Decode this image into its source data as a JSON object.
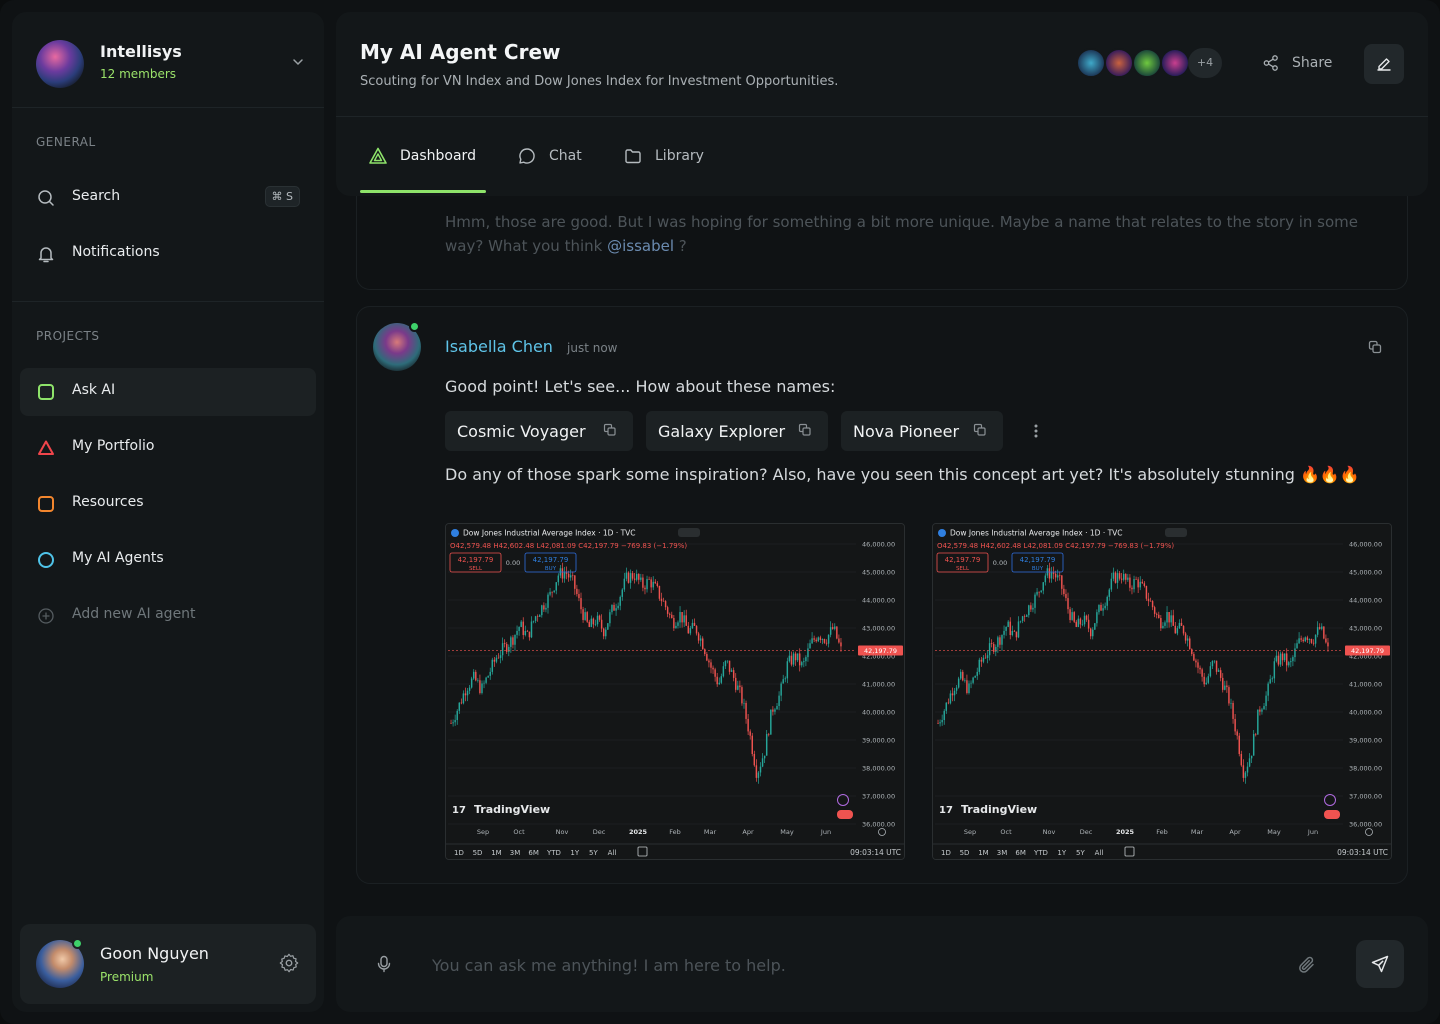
{
  "workspace": {
    "name": "Intellisys",
    "members": "12 members"
  },
  "sidebar": {
    "general_label": "GENERAL",
    "search_label": "Search",
    "search_shortcut": "⌘ S",
    "notifications_label": "Notifications",
    "projects_label": "PROJECTS",
    "projects": [
      {
        "label": "Ask AI",
        "color": "#8ee36a"
      },
      {
        "label": "My Portfolio",
        "color": "#f0454b"
      },
      {
        "label": "Resources",
        "color": "#f2862e"
      },
      {
        "label": "My AI Agents",
        "color": "#4fc3e8"
      }
    ],
    "add_agent_label": "Add new AI agent"
  },
  "user": {
    "name": "Goon Nguyen",
    "plan": "Premium"
  },
  "header": {
    "title": "My AI Agent Crew",
    "subtitle": "Scouting for VN Index and Dow Jones Index for Investment Opportunities.",
    "extra_members": "+4",
    "share_label": "Share"
  },
  "tabs": [
    {
      "label": "Dashboard"
    },
    {
      "label": "Chat"
    },
    {
      "label": "Library"
    }
  ],
  "previous_message": {
    "text": "Hmm, those are good. But I was hoping for something a bit more unique. Maybe a name that relates to the story in some way? What you think ",
    "mention": "@issabel",
    "suffix": " ?"
  },
  "message": {
    "author": "Isabella Chen",
    "time": "just now",
    "intro": "Good point! Let's see... How about these names:",
    "suggestions": [
      "Cosmic Voyager",
      "Galaxy Explorer",
      "Nova Pioneer"
    ],
    "followup": "Do any of those spark some inspiration? Also, have you seen this concept art yet? It's absolutely stunning 🔥🔥🔥"
  },
  "chart_data": [
    {
      "type": "candlestick",
      "title": "Dow Jones Industrial Average Index · 1D · TVC",
      "ohlc": "O42,579.48 H42,602.48 L42,081.09 C42,197.79 −769.83 (−1.79%)",
      "sell": "42,197.79",
      "sell_label": "SELL",
      "buy": "42,197.79",
      "buy_label": "BUY",
      "spread": "0.00",
      "last_price": "42,197.79",
      "y_ticks": [
        "46,000.00",
        "45,000.00",
        "44,000.00",
        "43,000.00",
        "42,000.00",
        "41,000.00",
        "40,000.00",
        "39,000.00",
        "38,000.00",
        "37,000.00",
        "36,000.00"
      ],
      "x_ticks": [
        "Sep",
        "Oct",
        "Nov",
        "Dec",
        "2025",
        "Feb",
        "Mar",
        "Apr",
        "May",
        "Jun"
      ],
      "ranges": [
        "1D",
        "5D",
        "1M",
        "3M",
        "6M",
        "YTD",
        "1Y",
        "5Y",
        "All"
      ],
      "clock": "09:03:14 UTC",
      "brand": "TradingView",
      "close_series": [
        39600,
        40200,
        40900,
        41200,
        40800,
        41400,
        42000,
        42300,
        42600,
        43100,
        42700,
        43400,
        43800,
        44200,
        44900,
        45000,
        44600,
        43700,
        43000,
        43300,
        42900,
        43600,
        44100,
        44800,
        44900,
        44500,
        44700,
        44300,
        43800,
        43200,
        43500,
        42900,
        43000,
        42400,
        41600,
        41000,
        41800,
        41200,
        40500,
        39300,
        37800,
        38600,
        40100,
        40600,
        41700,
        42000,
        41600,
        42400,
        42800,
        42600,
        43000,
        42200
      ]
    },
    {
      "type": "candlestick",
      "title": "Dow Jones Industrial Average Index · 1D · TVC",
      "ohlc": "O42,579.48 H42,602.48 L42,081.09 C42,197.79 −769.83 (−1.79%)",
      "sell": "42,197.79",
      "sell_label": "SELL",
      "buy": "42,197.79",
      "buy_label": "BUY",
      "spread": "0.00",
      "last_price": "42,197.79",
      "y_ticks": [
        "46,000.00",
        "45,000.00",
        "44,000.00",
        "43,000.00",
        "42,000.00",
        "41,000.00",
        "40,000.00",
        "39,000.00",
        "38,000.00",
        "37,000.00",
        "36,000.00"
      ],
      "x_ticks": [
        "Sep",
        "Oct",
        "Nov",
        "Dec",
        "2025",
        "Feb",
        "Mar",
        "Apr",
        "May",
        "Jun"
      ],
      "ranges": [
        "1D",
        "5D",
        "1M",
        "3M",
        "6M",
        "YTD",
        "1Y",
        "5Y",
        "All"
      ],
      "clock": "09:03:14 UTC",
      "brand": "TradingView",
      "close_series": [
        39600,
        40200,
        40900,
        41200,
        40800,
        41400,
        42000,
        42300,
        42600,
        43100,
        42700,
        43400,
        43800,
        44200,
        44900,
        45000,
        44600,
        43700,
        43000,
        43300,
        42900,
        43600,
        44100,
        44800,
        44900,
        44500,
        44700,
        44300,
        43800,
        43200,
        43500,
        42900,
        43000,
        42400,
        41600,
        41000,
        41800,
        41200,
        40500,
        39300,
        37800,
        38600,
        40100,
        40600,
        41700,
        42000,
        41600,
        42400,
        42800,
        42600,
        43000,
        42200
      ]
    }
  ],
  "input": {
    "placeholder": "You can ask me anything! I am here to help."
  },
  "colors": {
    "accent": "#8ee36a",
    "mention": "#5fc4e8",
    "up": "#26a69a",
    "down": "#ef5350"
  }
}
